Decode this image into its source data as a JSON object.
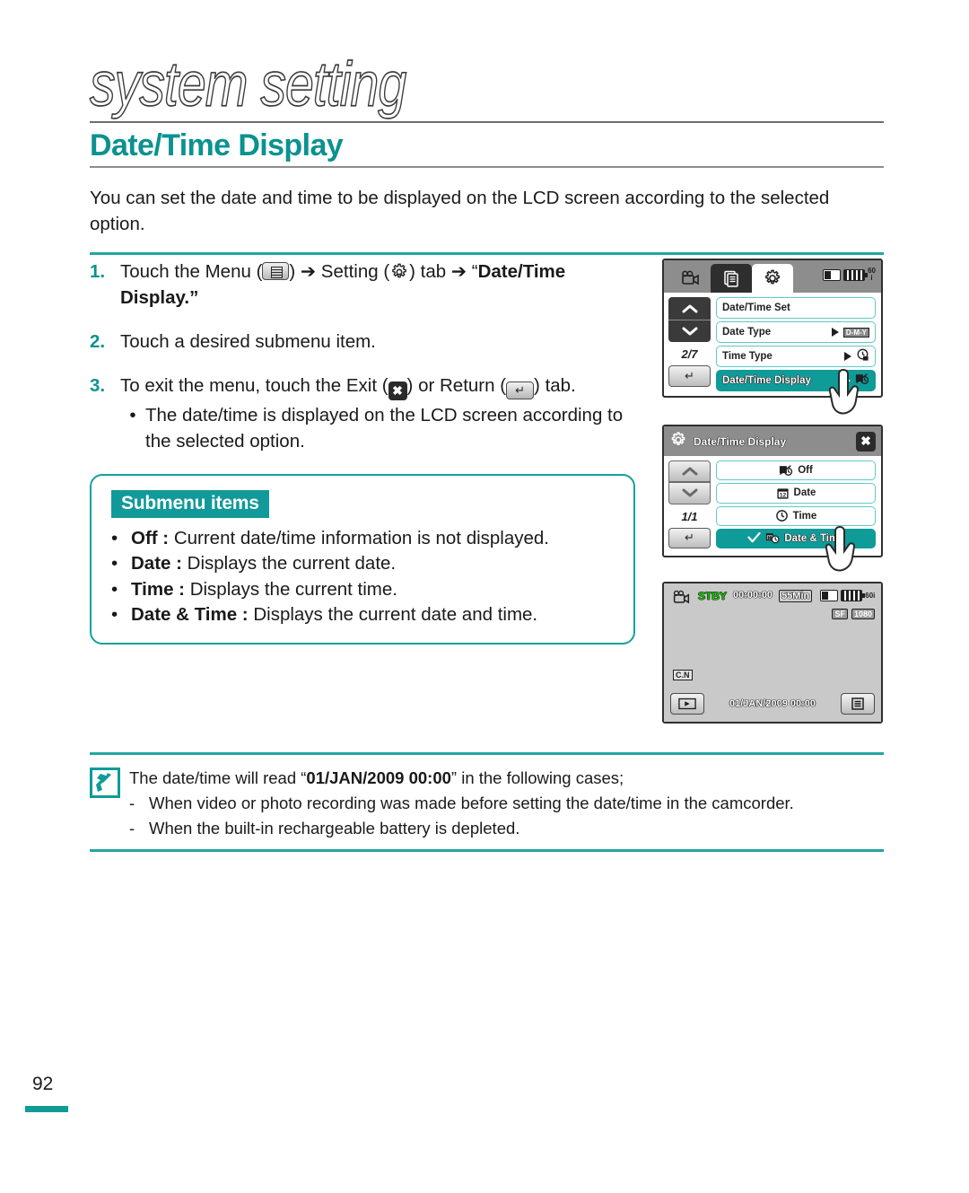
{
  "header": {
    "chapter": "system setting",
    "section": "Date/Time Display",
    "intro": "You can set the date and time to be displayed on the LCD screen according to the selected option."
  },
  "steps": [
    {
      "num": "1.",
      "text_a": "Touch the Menu (",
      "icon_a": "menu-icon",
      "text_b": ") ➔ Setting (",
      "icon_b": "gear-icon",
      "text_c": ") tab ➔ “",
      "bold": "Date/Time Display",
      "text_d": ".”"
    },
    {
      "num": "2.",
      "text": "Touch a desired submenu item."
    },
    {
      "num": "3.",
      "text_a": "To exit the menu, touch the Exit (",
      "icon_a": "exit-icon",
      "text_b": ") or Return (",
      "icon_b": "return-icon",
      "text_c": ") tab.",
      "bullets": [
        "The date/time is displayed on the LCD screen according to the selected option."
      ]
    }
  ],
  "submenu": {
    "tag": "Submenu items",
    "items": [
      {
        "term": "Off :",
        "desc": "Current date/time information is not displayed."
      },
      {
        "term": "Date :",
        "desc": "Displays the current date."
      },
      {
        "term": "Time :",
        "desc": "Displays the current time."
      },
      {
        "term": "Date & Time :",
        "desc": "Displays the current date and time."
      }
    ]
  },
  "lcd_menu": {
    "tabs": [
      "camcorder-tab",
      "document-tab",
      "setting-tab"
    ],
    "page_indicator": "2/7",
    "rows": [
      {
        "label": "Date/Time Set",
        "selected": false,
        "arrow": false,
        "icon": ""
      },
      {
        "label": "Date Type",
        "selected": false,
        "arrow": true,
        "icon": "D-M-Y"
      },
      {
        "label": "Time Type",
        "selected": false,
        "arrow": true,
        "icon": "clock-24"
      },
      {
        "label": "Date/Time Display",
        "selected": true,
        "arrow": true,
        "icon": "datetime-off"
      }
    ]
  },
  "lcd_submenu": {
    "title": "Date/Time Display",
    "page_indicator": "1/1",
    "rows": [
      {
        "label": "Off",
        "selected": false,
        "check": false,
        "icon": "datetime-off"
      },
      {
        "label": "Date",
        "selected": false,
        "check": false,
        "icon": "calendar-12"
      },
      {
        "label": "Time",
        "selected": false,
        "check": false,
        "icon": "clock"
      },
      {
        "label": "Date & Time",
        "selected": true,
        "check": true,
        "icon": "date-time"
      }
    ]
  },
  "lcd_record": {
    "mode": "STBY",
    "timecode": "00:00:00",
    "remaining": "55Min",
    "frame_rate": "60i",
    "quality": "SF",
    "resolution": "1080",
    "corner_tag": "C.N",
    "datetime": "01/JAN/2009 00:00",
    "play_button": "play-icon",
    "menu_button": "menu-icon"
  },
  "note": {
    "icon": "note-hand-icon",
    "line1_a": "The date/time will read “",
    "line1_bold": "01/JAN/2009 00:00",
    "line1_b": "” in the following cases;",
    "bullets": [
      "When video or photo recording was made before setting the date/time in the camcorder.",
      "When the built-in rechargeable battery is depleted."
    ]
  },
  "page_number": "92",
  "colors": {
    "teal": "#0f9b98",
    "teal_rule": "#22a6a3",
    "green": "#16c400"
  }
}
